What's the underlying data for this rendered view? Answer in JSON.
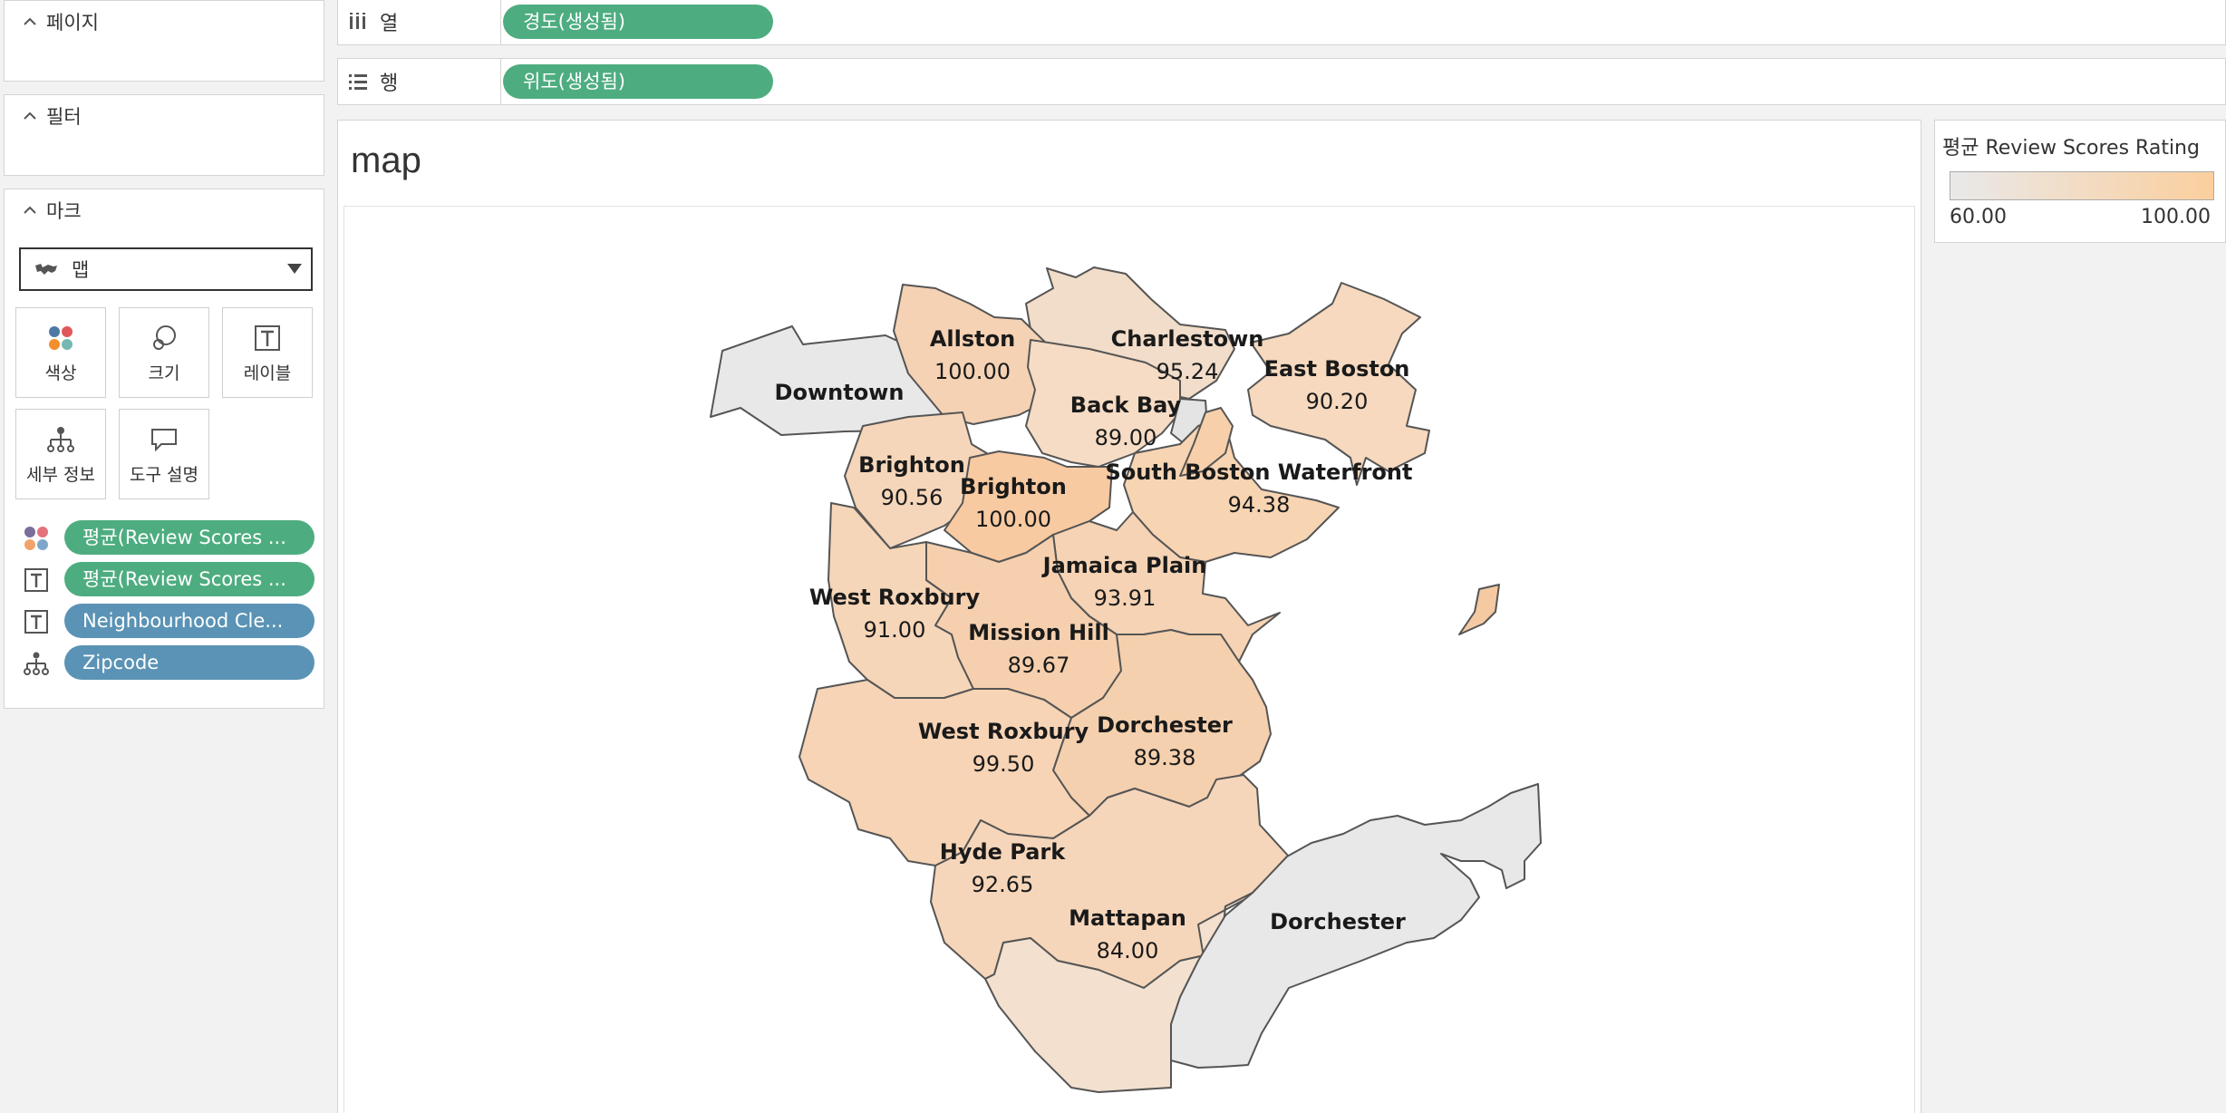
{
  "sidebar": {
    "pages": {
      "title": "페이지"
    },
    "filters": {
      "title": "필터"
    },
    "marks": {
      "title": "마크",
      "mark_type": "맵",
      "buttons": [
        "색상",
        "크기",
        "레이블",
        "세부 정보",
        "도구 설명"
      ],
      "fields": [
        {
          "icon": "color-icon",
          "label": "평균(Review Scores ...",
          "kind": "measure"
        },
        {
          "icon": "label-icon",
          "label": "평균(Review Scores ...",
          "kind": "measure"
        },
        {
          "icon": "label-icon",
          "label": "Neighbourhood Cle...",
          "kind": "dimension"
        },
        {
          "icon": "detail-icon",
          "label": "Zipcode",
          "kind": "dimension"
        }
      ]
    }
  },
  "shelves": {
    "columns": {
      "label": "열",
      "pill": "경도(생성됨)"
    },
    "rows": {
      "label": "행",
      "pill": "위도(생성됨)"
    }
  },
  "view": {
    "title": "map"
  },
  "legend": {
    "title": "평균 Review Scores Rating",
    "min": "60.00",
    "max": "100.00",
    "colors": {
      "low": "#e9e9e9",
      "high": "#fbcf9e"
    }
  },
  "map_labels": [
    {
      "name": "Allston",
      "value": "100.00"
    },
    {
      "name": "Charlestown",
      "value": "95.24"
    },
    {
      "name": "East Boston",
      "value": "90.20"
    },
    {
      "name": "Downtown",
      "value": ""
    },
    {
      "name": "Back Bay",
      "value": "89.00"
    },
    {
      "name": "Brighton",
      "value": "90.56"
    },
    {
      "name": "Brighton",
      "value": "100.00"
    },
    {
      "name": "South Boston Waterfront",
      "value": "94.38"
    },
    {
      "name": "Jamaica Plain",
      "value": "93.91"
    },
    {
      "name": "West Roxbury",
      "value": "91.00"
    },
    {
      "name": "Mission Hill",
      "value": "89.67"
    },
    {
      "name": "West Roxbury",
      "value": "99.50"
    },
    {
      "name": "Dorchester",
      "value": "89.38"
    },
    {
      "name": "Hyde Park",
      "value": "92.65"
    },
    {
      "name": "Mattapan",
      "value": "84.00"
    },
    {
      "name": "Dorchester",
      "value": ""
    }
  ]
}
